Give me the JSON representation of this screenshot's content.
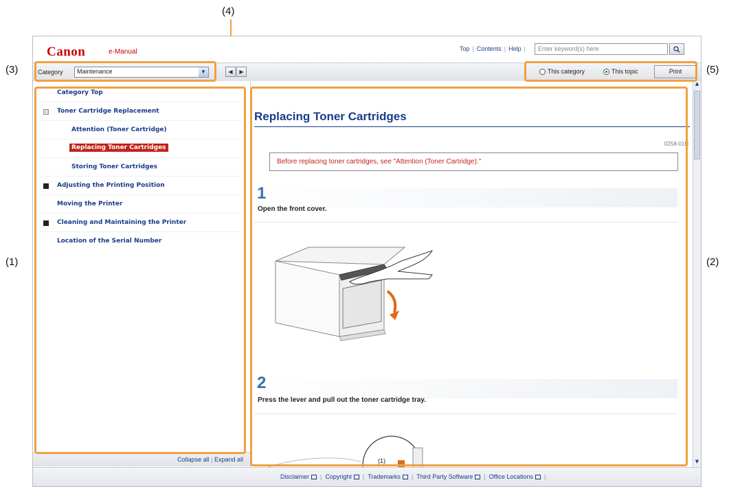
{
  "callouts": {
    "c1": "(1)",
    "c2": "(2)",
    "c3": "(3)",
    "c4": "(4)",
    "c5": "(5)"
  },
  "header": {
    "logo": "Canon",
    "product": "e-Manual",
    "links": [
      "Top",
      "Contents",
      "Help"
    ],
    "search_placeholder": "Enter keyword(s) here"
  },
  "toolbar": {
    "category_label": "Category",
    "category_value": "Maintenance",
    "radio_category": "This category",
    "radio_topic": "This topic",
    "print_label": "Print"
  },
  "sidebar": {
    "items": [
      {
        "label": "Category Top",
        "level": 0
      },
      {
        "label": "Toner Cartridge Replacement",
        "level": 0,
        "icon": "expanded"
      },
      {
        "label": "Attention (Toner Cartridge)",
        "level": 1
      },
      {
        "label": "Replacing Toner Cartridges",
        "level": 1,
        "selected": true
      },
      {
        "label": "Storing Toner Cartridges",
        "level": 1
      },
      {
        "label": "Adjusting the Printing Position",
        "level": 0,
        "icon": "collapsed"
      },
      {
        "label": "Moving the Printer",
        "level": 0
      },
      {
        "label": "Cleaning and Maintaining the Printer",
        "level": 0,
        "icon": "collapsed"
      },
      {
        "label": "Location of the Serial Number",
        "level": 0
      }
    ],
    "collapse_all": "Collapse all",
    "expand_all": "Expand all"
  },
  "content": {
    "title": "Replacing Toner Cartridges",
    "doc_id": "0258-01H",
    "notice": "Before replacing toner cartridges, see \"Attention (Toner Cartridge).\"",
    "steps": [
      {
        "number": "1",
        "text": "Open the front cover."
      },
      {
        "number": "2",
        "text": "Press the lever and pull out the toner cartridge tray."
      }
    ],
    "figure2_label": "(1)"
  },
  "footer": {
    "links": [
      "Disclaimer",
      "Copyright",
      "Trademarks",
      "Third Party Software",
      "Office Locations"
    ]
  },
  "colors": {
    "brand": "#cc0000",
    "link": "#1a3c8a",
    "highlight": "#f0a040",
    "selected": "#c0241a"
  }
}
